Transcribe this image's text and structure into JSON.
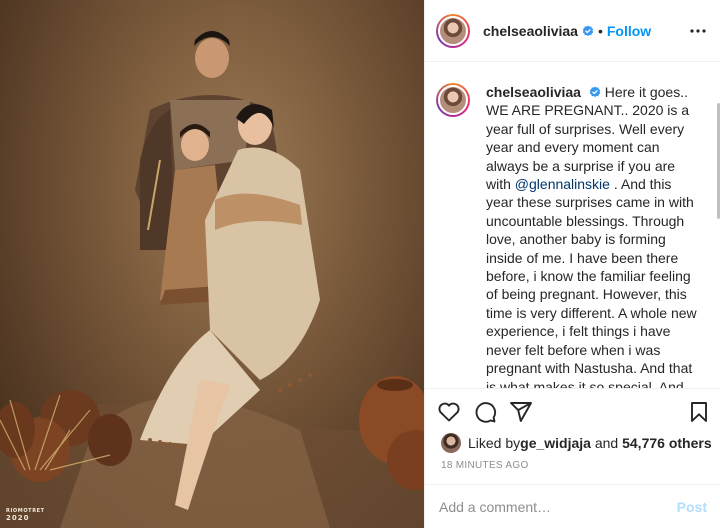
{
  "post": {
    "username": "chelseaoliviaa",
    "follow_label": "Follow",
    "separator": "•",
    "photo": {
      "description_icon": "family-portrait-image",
      "watermark_line1": "RIOMOTRET",
      "watermark_line2": "2020"
    },
    "caption": {
      "username": "chelseaoliviaa",
      "text_before_mention": "Here it goes.. WE ARE PREGNANT.. 2020 is a year full of surprises. Well every year and every moment can always be a surprise if you are with ",
      "mention": "@glennalinskie",
      "text_after_mention": " . And this year these surprises came in with uncountable blessings. Through love, another baby is forming inside of me. I have been there before, i know the familiar feeling of being pregnant. However, this time is very different. A whole new experience, i felt things i have never felt before when i was pregnant with Nastusha. And that is what makes it so special. And the thought of a little lovely creature forming inside of me is just so exhilarating. I want to thank all of you who gave your best wishes to our family 🤰"
    },
    "likes": {
      "prefix": "Liked by ",
      "first_user": "ge_widjaja",
      "middle": " and ",
      "others": "54,776 others"
    },
    "timestamp": "18 MINUTES AGO",
    "comment": {
      "placeholder": "Add a comment…",
      "post_label": "Post"
    },
    "colors": {
      "accent": "#0095f6",
      "mention": "#00376b",
      "post_disabled": "#b2dffc",
      "muted": "#8e8e8e"
    },
    "icons": [
      "verified-badge-icon",
      "more-options-icon",
      "heart-icon",
      "comment-icon",
      "share-icon",
      "bookmark-icon"
    ]
  }
}
